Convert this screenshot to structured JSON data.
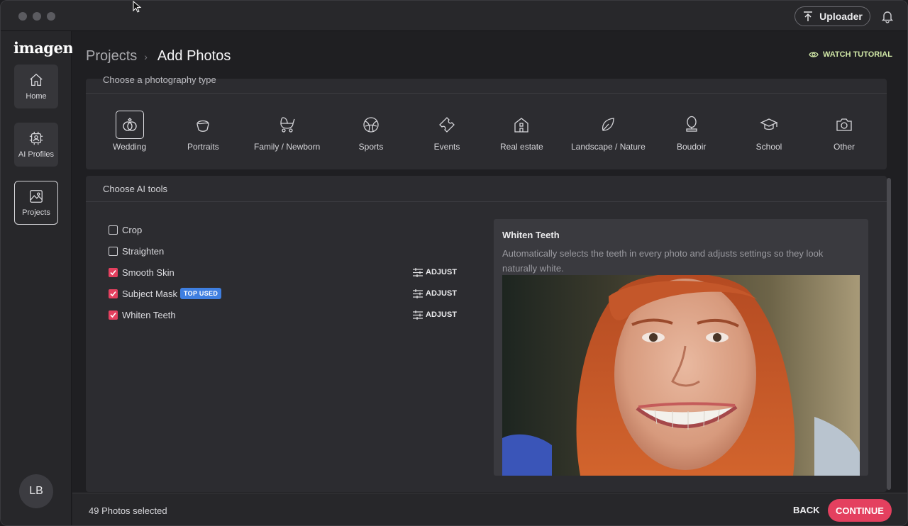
{
  "app": {
    "logo": "imagen"
  },
  "titlebar": {
    "uploader_label": "Uploader"
  },
  "sidebar": {
    "items": [
      {
        "label": "Home",
        "icon": "home-icon"
      },
      {
        "label": "AI Profiles",
        "icon": "ai-chip-icon"
      },
      {
        "label": "Projects",
        "icon": "image-icon",
        "active": true
      }
    ],
    "avatar_initials": "LB"
  },
  "header": {
    "breadcrumb_root": "Projects",
    "breadcrumb_current": "Add Photos",
    "watch_tutorial": "WATCH TUTORIAL"
  },
  "photography": {
    "title": "Choose a photography type",
    "types": [
      {
        "label": "Wedding",
        "icon": "rings-icon",
        "selected": true
      },
      {
        "label": "Portraits",
        "icon": "portrait-icon"
      },
      {
        "label": "Family / Newborn",
        "icon": "stroller-icon"
      },
      {
        "label": "Sports",
        "icon": "ball-icon"
      },
      {
        "label": "Events",
        "icon": "ticket-icon"
      },
      {
        "label": "Real estate",
        "icon": "house-icon"
      },
      {
        "label": "Landscape / Nature",
        "icon": "leaf-icon"
      },
      {
        "label": "Boudoir",
        "icon": "mirror-icon"
      },
      {
        "label": "School",
        "icon": "graduation-cap-icon"
      },
      {
        "label": "Other",
        "icon": "camera-icon"
      }
    ]
  },
  "ai_tools": {
    "title": "Choose AI tools",
    "adjust_label": "ADJUST",
    "tools": [
      {
        "label": "Crop",
        "checked": false,
        "adjust": false
      },
      {
        "label": "Straighten",
        "checked": false,
        "adjust": false
      },
      {
        "label": "Smooth Skin",
        "checked": true,
        "adjust": true
      },
      {
        "label": "Subject Mask",
        "checked": true,
        "adjust": true,
        "badge": "TOP USED"
      },
      {
        "label": "Whiten Teeth",
        "checked": true,
        "adjust": true
      }
    ],
    "preview": {
      "title": "Whiten Teeth",
      "description": "Automatically selects the teeth in every photo and adjusts settings so they look naturally white."
    }
  },
  "footer": {
    "selected_count": "49 Photos selected",
    "back_label": "BACK",
    "continue_label": "CONTINUE"
  },
  "colors": {
    "accent": "#e4405f",
    "badge": "#3f7fe0",
    "tutorial": "#cfe6a6"
  }
}
